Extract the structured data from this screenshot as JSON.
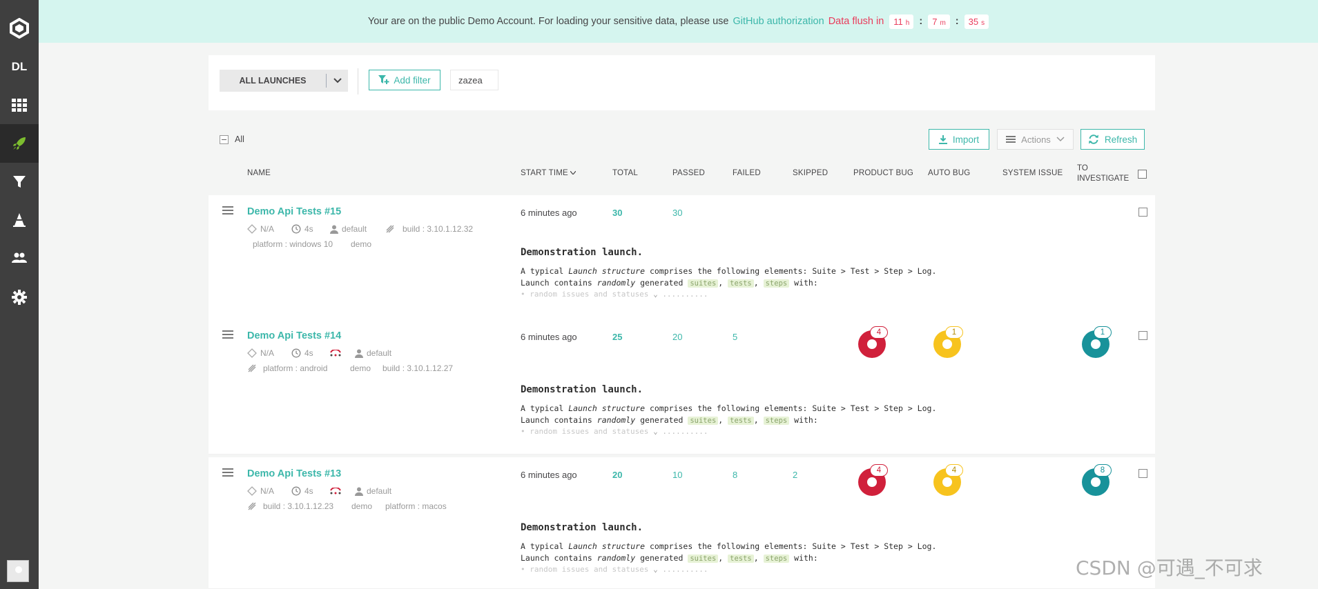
{
  "sidebar": {
    "logo": "reportportal-logo",
    "project_initials": "DL",
    "items": [
      {
        "name": "dashboards",
        "icon": "grid-icon"
      },
      {
        "name": "launches",
        "icon": "rocket-icon"
      },
      {
        "name": "filters",
        "icon": "filter-icon"
      },
      {
        "name": "debug",
        "icon": "cone-icon"
      },
      {
        "name": "members",
        "icon": "users-icon"
      },
      {
        "name": "settings",
        "icon": "gear-icon"
      }
    ]
  },
  "banner": {
    "text": "Your are on the public Demo Account. For loading your sensitive data, please use",
    "link": "GitHub authorization",
    "flush_label": "Data flush in",
    "hours": "11",
    "hours_unit": "h",
    "minutes": "7",
    "minutes_unit": "m",
    "seconds": "35",
    "seconds_unit": "s"
  },
  "filter_bar": {
    "select_label": "ALL LAUNCHES",
    "add_filter": "Add filter",
    "chip": "zazea"
  },
  "toolbar": {
    "all_label": "All",
    "import": "Import",
    "actions": "Actions",
    "refresh": "Refresh"
  },
  "columns": {
    "name": "NAME",
    "start_time": "START TIME",
    "total": "TOTAL",
    "passed": "PASSED",
    "failed": "FAILED",
    "skipped": "SKIPPED",
    "product_bug": "PRODUCT BUG",
    "auto_bug": "AUTO BUG",
    "system_issue": "SYSTEM ISSUE",
    "to_investigate_1": "TO",
    "to_investigate_2": "INVESTIGATE"
  },
  "description": {
    "heading": "Demonstration launch.",
    "line1_a": "A typical ",
    "line1_em": "Launch structure",
    "line1_b": " comprises the following elements: Suite > Test > Step > Log.",
    "line2_a": "Launch contains ",
    "line2_em": "randomly",
    "line2_b": " generated ",
    "code1": "suites",
    "code2": "tests",
    "code3": "steps",
    "line2_c": " with:",
    "line3": "• random issues and statuses"
  },
  "launches": [
    {
      "name": "Demo Api Tests #15",
      "na": "N/A",
      "duration": "4s",
      "owner": "default",
      "attr1": "build : 3.10.1.12.32",
      "attr2": "platform : windows 10",
      "attr3": "demo",
      "start": "6 minutes ago",
      "total": "30",
      "passed": "30",
      "failed": "",
      "skipped": ""
    },
    {
      "name": "Demo Api Tests #14",
      "na": "N/A",
      "duration": "4s",
      "owner": "default",
      "attr1": "platform : android",
      "attr2": "demo",
      "attr3": "build : 3.10.1.12.27",
      "start": "6 minutes ago",
      "total": "25",
      "passed": "20",
      "failed": "5",
      "skipped": "",
      "product_bug": "4",
      "auto_bug": "1",
      "to_investigate": "1"
    },
    {
      "name": "Demo Api Tests #13",
      "na": "N/A",
      "duration": "4s",
      "owner": "default",
      "attr1": "build : 3.10.1.12.23",
      "attr2": "demo",
      "attr3": "platform : macos",
      "start": "6 minutes ago",
      "total": "20",
      "passed": "10",
      "failed": "8",
      "skipped": "2",
      "product_bug": "4",
      "auto_bug": "4",
      "to_investigate": "8"
    }
  ],
  "colors": {
    "accent": "#3cb7aa",
    "product_bug": "#d0203b",
    "auto_bug": "#f7c31e",
    "to_investigate": "#18929a",
    "sidebar": "#3f3f3f",
    "banner": "#d5f5ef"
  },
  "watermark": "CSDN @可遇_不可求"
}
